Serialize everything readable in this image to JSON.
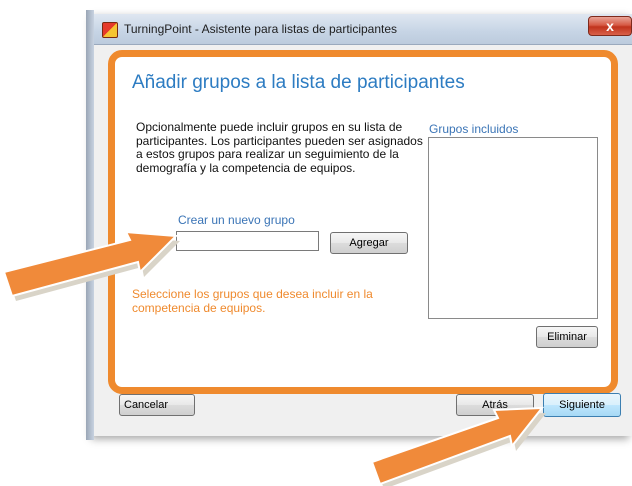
{
  "window": {
    "title": "TurningPoint - Asistente para listas de participantes",
    "close_symbol": "x"
  },
  "page": {
    "heading": "Añadir grupos a la lista de participantes",
    "description": "Opcionalmente puede incluir grupos en su lista de participantes.  Los participantes pueden ser asignados a estos grupos para realizar un seguimiento de la demografía y la competencia de equipos.",
    "new_group_label": "Crear un nuevo grupo",
    "new_group_value": "",
    "add_button": "Agregar",
    "hint": "Seleccione los grupos que desea incluir en la competencia de equipos.",
    "included_label": "Grupos incluidos",
    "included_items": [],
    "remove_button": "Eliminar"
  },
  "footer": {
    "cancel_button": "Cancelar",
    "back_button": "Atrás",
    "next_button": "Siguiente"
  },
  "colors": {
    "accent_orange": "#ef8a2e",
    "heading_blue": "#2d7cc2",
    "arrow_orange": "#f08a3a"
  },
  "icons": {
    "app": "turningpoint-app-icon",
    "close": "close-icon",
    "pointer_arrows": "callout-arrow"
  }
}
